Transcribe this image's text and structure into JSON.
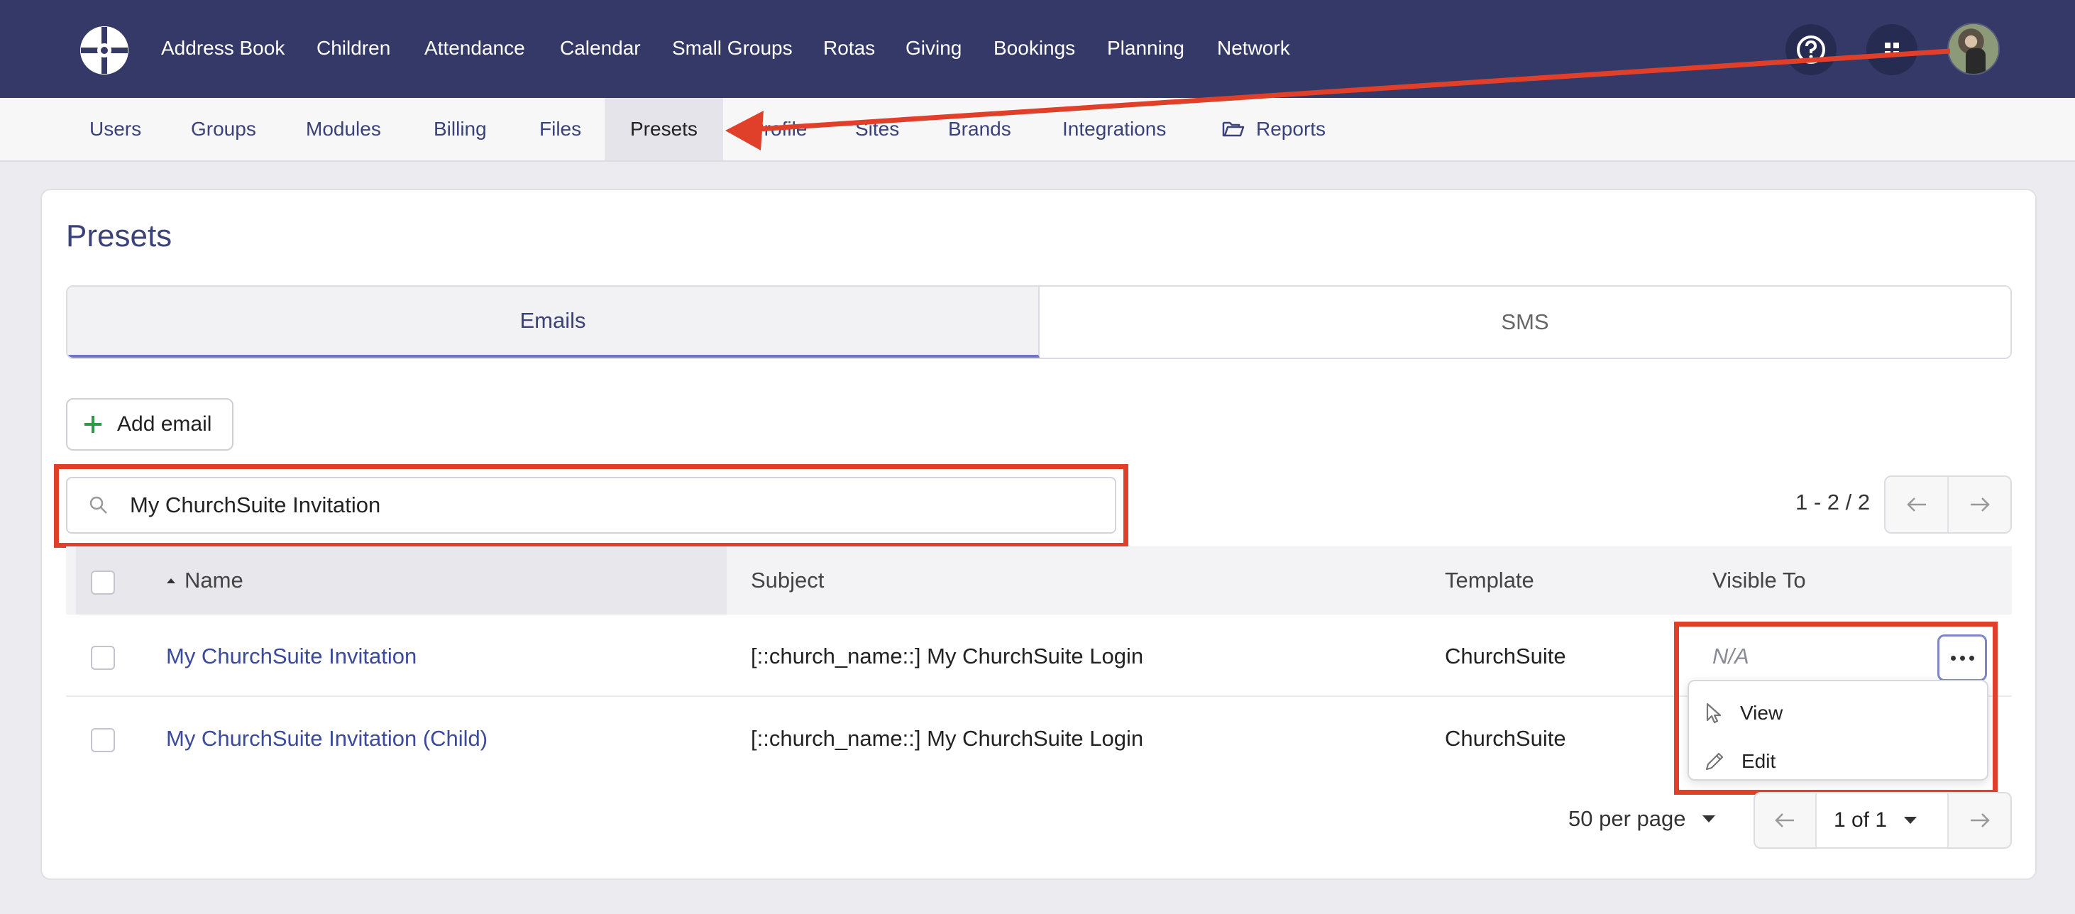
{
  "nav": {
    "items": [
      "Address Book",
      "Children",
      "Attendance",
      "Calendar",
      "Small Groups",
      "Rotas",
      "Giving",
      "Bookings",
      "Planning",
      "Network"
    ]
  },
  "subnav": {
    "items": [
      "Users",
      "Groups",
      "Modules",
      "Billing",
      "Files",
      "Presets",
      "Profile",
      "Sites",
      "Brands",
      "Integrations",
      "Reports"
    ],
    "active": "Presets"
  },
  "page": {
    "title": "Presets"
  },
  "tabs": {
    "emails": "Emails",
    "sms": "SMS"
  },
  "toolbar": {
    "add_label": "Add email"
  },
  "search": {
    "value": "My ChurchSuite Invitation"
  },
  "pagination_top": {
    "range": "1 - 2 / 2"
  },
  "table": {
    "headers": {
      "name": "Name",
      "subject": "Subject",
      "template": "Template",
      "visible_to": "Visible To"
    },
    "rows": [
      {
        "name": "My ChurchSuite Invitation",
        "subject": "[::church_name::] My ChurchSuite Login",
        "template": "ChurchSuite",
        "visible_to": "N/A"
      },
      {
        "name": "My ChurchSuite Invitation (Child)",
        "subject": "[::church_name::] My ChurchSuite Login",
        "template": "ChurchSuite",
        "visible_to": ""
      }
    ]
  },
  "row_menu": {
    "view": "View",
    "edit": "Edit"
  },
  "pagination_bottom": {
    "per_page": "50 per page",
    "page": "1 of 1"
  },
  "colors": {
    "nav_bg": "#343967",
    "accent": "#3b4279",
    "annotation": "#e0402a",
    "add_icon": "#2e9a48"
  }
}
